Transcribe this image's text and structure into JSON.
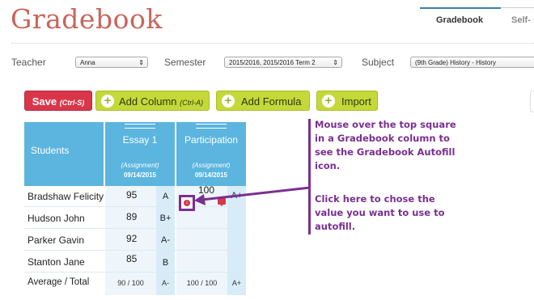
{
  "page": {
    "title": "Gradebook"
  },
  "tabs": [
    {
      "label": "Gradebook"
    },
    {
      "label": "Self-"
    }
  ],
  "filters": {
    "teacher_label": "Teacher",
    "teacher_value": "Anna",
    "semester_label": "Semester",
    "semester_value": "2015/2016, 2015/2016 Term 2",
    "subject_label": "Subject",
    "subject_value": "(9th Grade) History - History"
  },
  "toolbar": {
    "save_label": "Save",
    "save_shortcut": "(Ctrl-S)",
    "add_column_label": "Add Column",
    "add_column_shortcut": "(Ctrl-A)",
    "add_formula_label": "Add Formula",
    "import_label": "Import"
  },
  "table": {
    "students_header": "Students",
    "columns": [
      {
        "title": "Essay 1",
        "type": "(Assignment)",
        "date": "09/14/2015"
      },
      {
        "title": "Participation",
        "type": "(Assignment)",
        "date": "09/14/2015"
      }
    ],
    "rows": [
      {
        "name": "Bradshaw Felicity",
        "score1": "95",
        "grade1": "A",
        "score2": "100",
        "grade2": "A+"
      },
      {
        "name": "Hudson John",
        "score1": "89",
        "grade1": "B+",
        "score2": "",
        "grade2": ""
      },
      {
        "name": "Parker Gavin",
        "score1": "92",
        "grade1": "A-",
        "score2": "",
        "grade2": ""
      },
      {
        "name": "Stanton Jane",
        "score1": "85",
        "grade1": "B",
        "score2": "",
        "grade2": ""
      }
    ],
    "average": {
      "label": "Average / Total",
      "score1": "90 / 100",
      "grade1": "A-",
      "score2": "100 / 100",
      "grade2": "A+"
    }
  },
  "callout": {
    "lines1": [
      "Mouse over the top square",
      "in a Gradebook column to",
      "see the Gradebook Autofill",
      "icon."
    ],
    "lines2": [
      "Click here to chose the",
      "value you want to use to",
      "autofill."
    ]
  },
  "colors": {
    "accent": "#5bb5de",
    "brand": "#c8655a",
    "save": "#d9364a",
    "lime": "#c4d939",
    "callout": "#7a2f90"
  }
}
